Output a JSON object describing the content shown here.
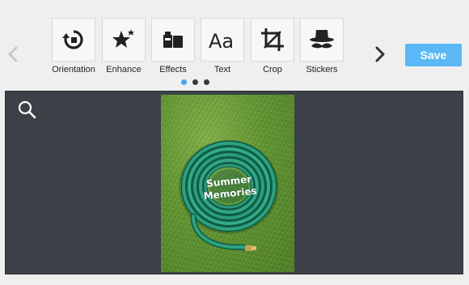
{
  "toolbar": {
    "tools": [
      {
        "label": "Orientation",
        "icon": "rotate-icon"
      },
      {
        "label": "Enhance",
        "icon": "magic-wand-icon"
      },
      {
        "label": "Effects",
        "icon": "effects-palette-icon"
      },
      {
        "label": "Text",
        "icon": "text-aa-icon"
      },
      {
        "label": "Crop",
        "icon": "crop-icon"
      },
      {
        "label": "Stickers",
        "icon": "hat-mustache-icon"
      }
    ],
    "pagination": {
      "pages": 3,
      "active": 1
    },
    "save_label": "Save"
  },
  "canvas": {
    "photo": {
      "caption_line1": "Summer",
      "caption_line2": "Memories"
    }
  },
  "colors": {
    "accent": "#59b8f5",
    "canvas_bg": "#3b4147",
    "toolbar_bg": "#efefef",
    "active_dot": "#45a8f0"
  }
}
